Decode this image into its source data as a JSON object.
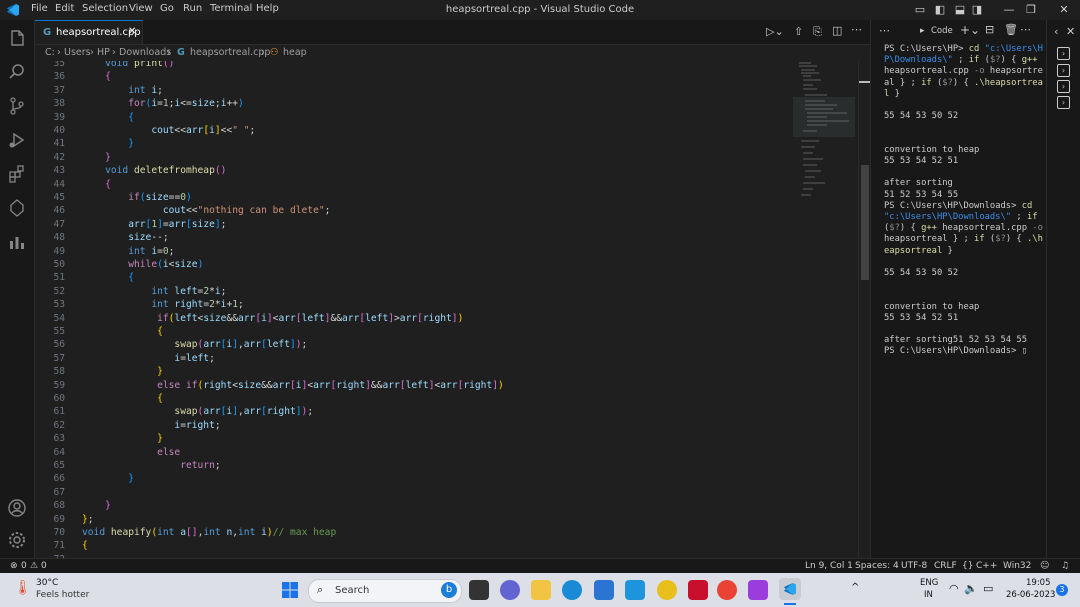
{
  "titlebar": {
    "menus": [
      "File",
      "Edit",
      "Selection",
      "View",
      "Go",
      "Run",
      "Terminal",
      "Help"
    ],
    "title": "heapsortreal.cpp - Visual Studio Code"
  },
  "tab": {
    "label": "heapsortreal.cpp"
  },
  "breadcrumb": [
    "C:",
    "Users",
    "HP",
    "Downloads",
    "heapsortreal.cpp",
    "heap"
  ],
  "code": {
    "lines": [
      {
        "n": "35",
        "h": "    <span class='ty'>void</span> <span class='fn'>print</span><span class='b2'>()</span>"
      },
      {
        "n": "36",
        "h": "    <span class='b2'>{</span>"
      },
      {
        "n": "37",
        "h": "        <span class='ty'>int</span> <span class='var'>i</span>;"
      },
      {
        "n": "38",
        "h": "        <span class='ctl'>for</span><span class='b3'>(</span><span class='var'>i</span>=<span class='num'>1</span>;<span class='var'>i</span>&lt;=<span class='var'>size</span>;<span class='var'>i</span>++<span class='b3'>)</span>"
      },
      {
        "n": "39",
        "h": "        <span class='b3'>{</span>"
      },
      {
        "n": "40",
        "h": "            <span class='var'>cout</span>&lt;&lt;<span class='var'>arr</span><span class='b1'>[</span><span class='var'>i</span><span class='b1'>]</span>&lt;&lt;<span class='str'>\" \"</span>;"
      },
      {
        "n": "41",
        "h": "        <span class='b3'>}</span>"
      },
      {
        "n": "42",
        "h": "    <span class='b2'>}</span>"
      },
      {
        "n": "43",
        "h": "    <span class='ty'>void</span> <span class='fn'>deletefromheap</span><span class='b2'>()</span>"
      },
      {
        "n": "44",
        "h": "    <span class='b2'>{</span>"
      },
      {
        "n": "45",
        "h": "        <span class='ctl'>if</span><span class='b3'>(</span><span class='var'>size</span>==<span class='num'>0</span><span class='b3'>)</span>"
      },
      {
        "n": "46",
        "h": "              <span class='var'>cout</span>&lt;&lt;<span class='str'>\"nothing can be dlete\"</span>;"
      },
      {
        "n": "47",
        "h": "        <span class='var'>arr</span><span class='b3'>[</span><span class='num'>1</span><span class='b3'>]</span>=<span class='var'>arr</span><span class='b3'>[</span><span class='var'>size</span><span class='b3'>]</span>;"
      },
      {
        "n": "48",
        "h": "        <span class='var'>size</span>--;"
      },
      {
        "n": "49",
        "h": "        <span class='ty'>int</span> <span class='var'>i</span>=<span class='num'>0</span>;"
      },
      {
        "n": "50",
        "h": "        <span class='ctl'>while</span><span class='b3'>(</span><span class='var'>i</span>&lt;<span class='var'>size</span><span class='b3'>)</span>"
      },
      {
        "n": "51",
        "h": "        <span class='b3'>{</span>"
      },
      {
        "n": "52",
        "h": "            <span class='ty'>int</span> <span class='var'>left</span>=<span class='num'>2</span>*<span class='var'>i</span>;"
      },
      {
        "n": "53",
        "h": "            <span class='ty'>int</span> <span class='var'>right</span>=<span class='num'>2</span>*<span class='var'>i</span>+<span class='num'>1</span>;"
      },
      {
        "n": "54",
        "h": "             <span class='ctl'>if</span><span class='b1'>(</span><span class='var'>left</span>&lt;<span class='var'>size</span>&amp;&amp;<span class='var'>arr</span><span class='b2'>[</span><span class='var'>i</span><span class='b2'>]</span>&lt;<span class='var'>arr</span><span class='b2'>[</span><span class='var'>left</span><span class='b2'>]</span>&amp;&amp;<span class='var'>arr</span><span class='b2'>[</span><span class='var'>left</span><span class='b2'>]</span>&gt;<span class='var'>arr</span><span class='b2'>[</span><span class='var'>right</span><span class='b2'>]</span><span class='b1'>)</span>"
      },
      {
        "n": "55",
        "h": "             <span class='b1'>{</span>"
      },
      {
        "n": "56",
        "h": "                <span class='fn'>swap</span><span class='b2'>(</span><span class='var'>arr</span><span class='b3'>[</span><span class='var'>i</span><span class='b3'>]</span>,<span class='var'>arr</span><span class='b3'>[</span><span class='var'>left</span><span class='b3'>]</span><span class='b2'>)</span>;"
      },
      {
        "n": "57",
        "h": "                <span class='var'>i</span>=<span class='var'>left</span>;"
      },
      {
        "n": "58",
        "h": "             <span class='b1'>}</span>"
      },
      {
        "n": "59",
        "h": "             <span class='ctl'>else</span> <span class='ctl'>if</span><span class='b1'>(</span><span class='var'>right</span>&lt;<span class='var'>size</span>&amp;&amp;<span class='var'>arr</span><span class='b2'>[</span><span class='var'>i</span><span class='b2'>]</span>&lt;<span class='var'>arr</span><span class='b2'>[</span><span class='var'>right</span><span class='b2'>]</span>&amp;&amp;<span class='var'>arr</span><span class='b2'>[</span><span class='var'>left</span><span class='b2'>]</span>&lt;<span class='var'>arr</span><span class='b2'>[</span><span class='var'>right</span><span class='b2'>]</span><span class='b1'>)</span>"
      },
      {
        "n": "60",
        "h": "             <span class='b1'>{</span>"
      },
      {
        "n": "61",
        "h": "                <span class='fn'>swap</span><span class='b2'>(</span><span class='var'>arr</span><span class='b3'>[</span><span class='var'>i</span><span class='b3'>]</span>,<span class='var'>arr</span><span class='b3'>[</span><span class='var'>right</span><span class='b3'>]</span><span class='b2'>)</span>;"
      },
      {
        "n": "62",
        "h": "                <span class='var'>i</span>=<span class='var'>right</span>;"
      },
      {
        "n": "63",
        "h": "             <span class='b1'>}</span>"
      },
      {
        "n": "64",
        "h": "             <span class='ctl'>else</span>"
      },
      {
        "n": "65",
        "h": "                 <span class='ctl'>return</span>;"
      },
      {
        "n": "66",
        "h": "        <span class='b3'>}</span>"
      },
      {
        "n": "67",
        "h": ""
      },
      {
        "n": "68",
        "h": "    <span class='b2'>}</span>"
      },
      {
        "n": "69",
        "h": "<span class='b1'>}</span>;"
      },
      {
        "n": "70",
        "h": "<span class='ty'>void</span> <span class='fn'>heapify</span><span class='b1'>(</span><span class='ty'>int</span> <span class='var'>a</span><span class='b2'>[]</span>,<span class='ty'>int</span> <span class='var'>n</span>,<span class='ty'>int</span> <span class='var'>i</span><span class='b1'>)</span><span class='cm'>// max heap</span>"
      },
      {
        "n": "71",
        "h": "<span class='b1'>{</span>"
      },
      {
        "n": "72",
        "h": ""
      }
    ]
  },
  "terminal": {
    "header_label": "Code",
    "html": "PS C:\\Users\\HP&gt; <span class='t-y'>cd</span> <span class='t-b'>\"c:\\Users\\HP\\Downloads\\\"</span> ; <span class='t-y'>if</span> (<span class='t-g'>$?</span>) { <span class='t-y'>g++</span> heapsortreal.cpp <span class='t-g'>-o</span> heapsortreal } ; <span class='t-y'>if</span> (<span class='t-g'>$?</span>) { <span class='t-y'>.\\heapsortreal</span> }\n\n55 54 53 50 52\n\n\nconvertion to heap\n55 53 54 52 51\n\nafter sorting\n51 52 53 54 55\nPS C:\\Users\\HP\\Downloads&gt; <span class='t-y'>cd</span> <span class='t-b'>\"c:\\Users\\HP\\Downloads\\\"</span> ; <span class='t-y'>if</span> (<span class='t-g'>$?</span>) { <span class='t-y'>g++</span> heapsortreal.cpp <span class='t-g'>-o</span> heapsortreal } ; <span class='t-y'>if</span> (<span class='t-g'>$?</span>) { <span class='t-y'>.\\heapsortreal</span> }\n\n55 54 53 50 52\n\n\nconvertion to heap\n55 53 54 52 51\n\nafter sorting51 52 53 54 55\nPS C:\\Users\\HP\\Downloads&gt; ▯"
  },
  "status": {
    "errors": "0",
    "warnings": "0",
    "position": "Ln 9, Col 1",
    "spaces": "Spaces: 4",
    "encoding": "UTF-8",
    "eol": "CRLF",
    "language": "C++",
    "platform": "Win32"
  },
  "taskbar": {
    "weather_temp": "30°C",
    "weather_desc": "Feels hotter",
    "search_placeholder": "Search",
    "lang_top": "ENG",
    "lang_bottom": "IN",
    "time": "19:05",
    "date": "26-06-2023",
    "notif_count": "3"
  },
  "colors": {
    "accent": "#0078d4",
    "editor_bg": "#1f1f1f",
    "taskbar_bg": "#dcdfe6"
  }
}
